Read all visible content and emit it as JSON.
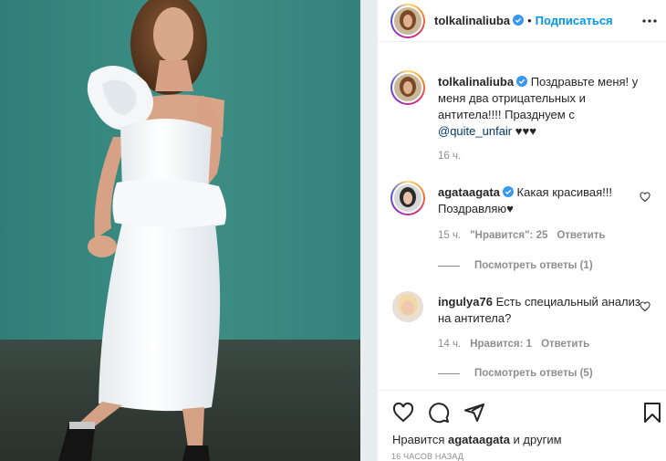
{
  "post": {
    "author": "tolkalinaliuba",
    "follow_label": "Подписаться",
    "dot": "•"
  },
  "caption": {
    "author": "tolkalinaliuba",
    "text": "Поздравьте меня! у меня два отрицательных и антитела!!!! Празднуем с",
    "mention": "@quite_unfair",
    "hearts": "♥♥♥",
    "time": "16 ч."
  },
  "comments": [
    {
      "author": "agataagata",
      "text": "Какая красивая!!! Поздравляю♥",
      "time": "15 ч.",
      "likes": "\"Нравится\": 25",
      "reply": "Ответить",
      "view_replies": "Посмотреть ответы (1)"
    },
    {
      "author": "ingulya76",
      "text": "Есть специальный анализ на антитела?",
      "time": "14 ч.",
      "likes": "Нравится: 1",
      "reply": "Ответить",
      "view_replies": "Посмотреть ответы (5)"
    }
  ],
  "likes": {
    "prefix": "Нравится",
    "user": "agataagata",
    "suffix": "и другим"
  },
  "timestamp": "16 ЧАСОВ НАЗАД",
  "icons": [
    "more-icon",
    "verified-badge-icon",
    "heart-icon",
    "comment-icon",
    "share-icon",
    "bookmark-icon"
  ],
  "colors": {
    "link": "#0095f6",
    "mention": "#00376b",
    "muted": "#8e8e8e",
    "wall": "#3d8a80"
  }
}
